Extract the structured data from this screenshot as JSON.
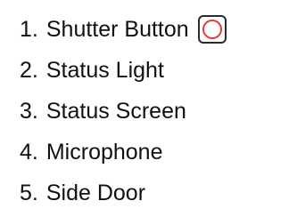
{
  "legend": {
    "items": [
      {
        "number": "1.",
        "label": "Shutter Button",
        "icon": "shutter-button-icon"
      },
      {
        "number": "2.",
        "label": "Status Light"
      },
      {
        "number": "3.",
        "label": "Status Screen"
      },
      {
        "number": "4.",
        "label": "Microphone"
      },
      {
        "number": "5.",
        "label": "Side Door"
      }
    ]
  },
  "colors": {
    "text": "#111111",
    "icon_frame": "#2b2b2b",
    "icon_ring": "#e03a3a"
  }
}
